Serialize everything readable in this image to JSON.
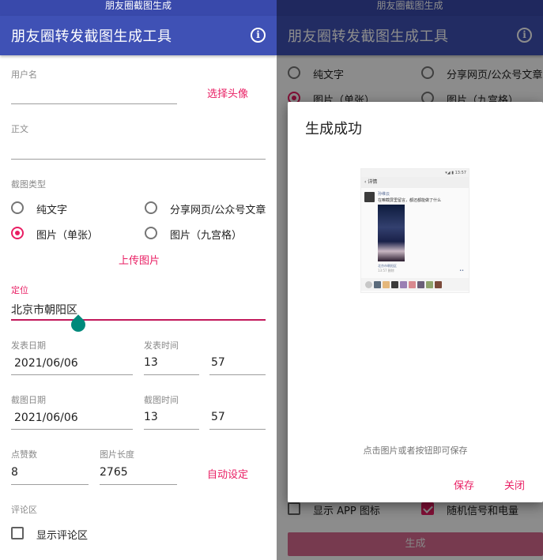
{
  "status_bar": {
    "title": "朋友圈截图生成"
  },
  "app_bar": {
    "title": "朋友圈转发截图生成工具"
  },
  "form": {
    "username_label": "用户名",
    "choose_avatar": "选择头像",
    "body_label": "正文",
    "type_label": "截图类型",
    "types": [
      {
        "label": "纯文字",
        "selected": false
      },
      {
        "label": "分享网页/公众号文章",
        "selected": false
      },
      {
        "label": "图片（单张）",
        "selected": true
      },
      {
        "label": "图片（九宫格）",
        "selected": false
      }
    ],
    "upload_image": "上传图片",
    "location_label": "定位",
    "location_value": "北京市朝阳区",
    "post_date_label": "发表日期",
    "post_date_value": "2021/06/06",
    "post_time_label": "发表时间",
    "post_hour": "13",
    "post_minute": "57",
    "shot_date_label": "截图日期",
    "shot_date_value": "2021/06/06",
    "shot_time_label": "截图时间",
    "shot_hour": "13",
    "shot_minute": "57",
    "likes_label": "点赞数",
    "likes_value": "8",
    "length_label": "图片长度",
    "length_value": "2765",
    "auto_set": "自动设定",
    "comments_label": "评论区",
    "show_comments": "显示评论区",
    "show_app_icon": "显示 APP 图标",
    "random_signal": "随机信号和电量",
    "generate_button": "生成"
  },
  "dialog": {
    "title": "生成成功",
    "hint": "点击图片或者按钮即可保存",
    "save": "保存",
    "close": "关闭",
    "preview": {
      "status": "▾◢ ▮ 13:57",
      "header": "‹  详情",
      "name": "孙维云",
      "text": "在嘛截屏里留言，都还都能做了什么",
      "source": "北京市朝阳区",
      "time": "13:57  删除",
      "more": "••"
    }
  },
  "colors": {
    "primary": "#3f51b5",
    "status": "#3949ab",
    "accent": "#e91e63",
    "handle": "#00897b"
  }
}
